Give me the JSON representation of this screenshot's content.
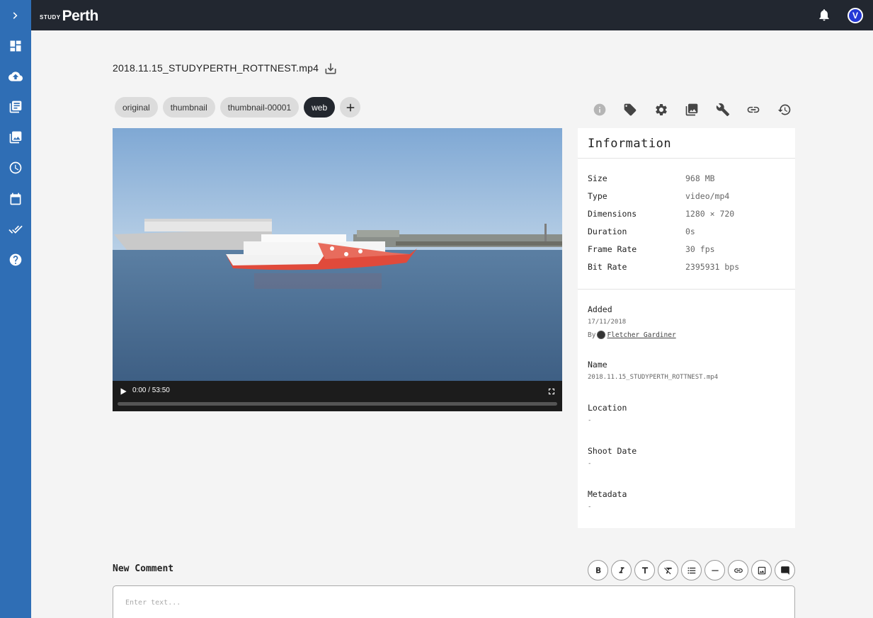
{
  "brand": {
    "prefix": "STUDY",
    "name": "Perth"
  },
  "user": {
    "initial": "V"
  },
  "file": {
    "title": "2018.11.15_STUDYPERTH_ROTTNEST.mp4"
  },
  "renditions": [
    "original",
    "thumbnail",
    "thumbnail-00001",
    "web"
  ],
  "active_rendition": "web",
  "video": {
    "time_label": "0:00 / 53:50",
    "progress": 0
  },
  "info": {
    "title": "Information",
    "rows": [
      {
        "key": "Size",
        "value": "968 MB"
      },
      {
        "key": "Type",
        "value": "video/mp4"
      },
      {
        "key": "Dimensions",
        "value": "1280 × 720"
      },
      {
        "key": "Duration",
        "value": "0s"
      },
      {
        "key": "Frame Rate",
        "value": "30 fps"
      },
      {
        "key": "Bit Rate",
        "value": "2395931 bps"
      }
    ],
    "added_label": "Added",
    "added_date": "17/11/2018",
    "added_by_prefix": "By",
    "added_by_name": "Fletcher Gardiner",
    "name_label": "Name",
    "name_value": "2018.11.15_STUDYPERTH_ROTTNEST.mp4",
    "location_label": "Location",
    "location_value": "-",
    "shoot_date_label": "Shoot Date",
    "shoot_date_value": "-",
    "metadata_label": "Metadata",
    "metadata_value": "-"
  },
  "comment": {
    "title": "New Comment",
    "placeholder": "Enter text..."
  }
}
